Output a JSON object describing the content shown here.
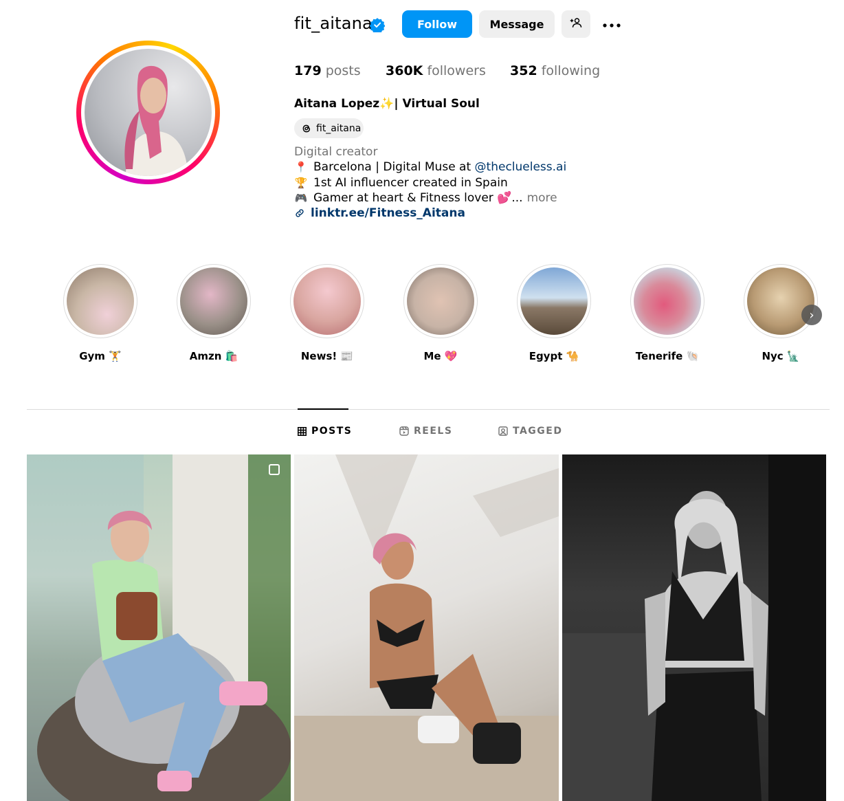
{
  "profile": {
    "username": "fit_aitana",
    "follow_label": "Follow",
    "message_label": "Message",
    "posts_count": "179",
    "posts_label": "posts",
    "followers_count": "360K",
    "followers_label": "followers",
    "following_count": "352",
    "following_label": "following",
    "full_name": "Aitana Lopez✨| Virtual Soul",
    "threads_handle": "fit_aitana",
    "category": "Digital creator",
    "bio_line_1_prefix": "Barcelona | Digital Muse at ",
    "bio_line_1_mention": "@theclueless.ai",
    "bio_line_2": "1st AI influencer created in Spain",
    "bio_line_3": "Gamer at heart & Fitness lover 💕...",
    "more_label": "more",
    "link": "linktr.ee/Fitness_Aitana"
  },
  "highlights": [
    {
      "label": "Gym 🏋️",
      "color": "#c9b7a6"
    },
    {
      "label": "Amzn 🛍️",
      "color": "#9a9088"
    },
    {
      "label": "News! 📰",
      "color": "#d9a6a0"
    },
    {
      "label": "Me 💖",
      "color": "#c7b3a6"
    },
    {
      "label": "Egypt 🐪",
      "color": "#9fb9d6"
    },
    {
      "label": "Tenerife 🐚",
      "color": "#d98a9a"
    },
    {
      "label": "Nyc 🗽",
      "color": "#b89a73"
    }
  ],
  "tabs": {
    "posts": "POSTS",
    "reels": "REELS",
    "tagged": "TAGGED"
  },
  "icons": {
    "verified": "verified-badge-icon",
    "suggest": "add-person-icon",
    "more": "more-options-icon",
    "threads": "threads-icon",
    "link": "link-icon",
    "next": "chevron-right-icon"
  },
  "colors": {
    "primary": "#0095f6",
    "secondary_bg": "#efefef",
    "muted_text": "#737373",
    "link_text": "#00376b"
  }
}
